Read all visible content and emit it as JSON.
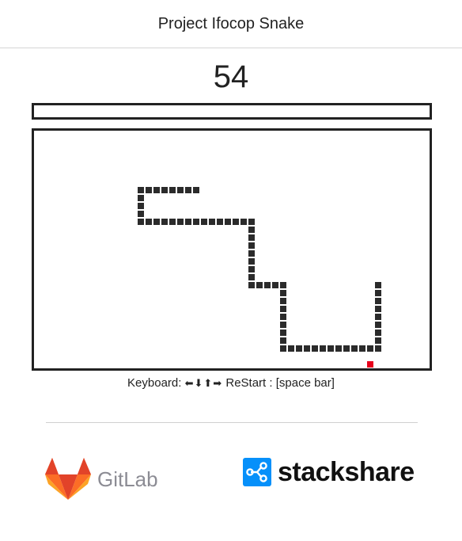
{
  "header": {
    "title": "Project Ifocop Snake"
  },
  "score": {
    "value": "54"
  },
  "progress": {
    "fraction": 0
  },
  "board": {
    "cols": 50,
    "rows": 30,
    "snake_color": "#2b2b2b",
    "food_color": "#e8001c",
    "food": [
      42,
      29
    ],
    "snake_path": [
      [
        20,
        7
      ],
      [
        13,
        7
      ],
      [
        13,
        11
      ],
      [
        27,
        11
      ],
      [
        27,
        19
      ],
      [
        31,
        19
      ],
      [
        31,
        27
      ],
      [
        43,
        27
      ],
      [
        43,
        19
      ]
    ]
  },
  "controls": {
    "prefix": "Keyboard:",
    "keys": "⬅⬇⬆➡",
    "restart": "ReStart : [space bar]"
  },
  "footer": {
    "gitlab_label": "GitLab",
    "gitlab_colors": [
      "#e24329",
      "#fc6d26",
      "#fca326"
    ],
    "stackshare_label": "stackshare",
    "stackshare_color": "#0690fa"
  }
}
